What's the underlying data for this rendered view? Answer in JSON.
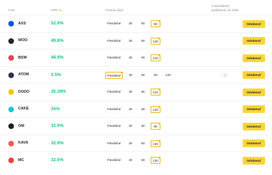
{
  "header": {
    "coin": "Coin",
    "apr": "APR",
    "duration": "Trvanie (dni)",
    "auto_subscribe": "Automatické pridávanie na sobe:"
  },
  "colors": {
    "accent": "#f0b90b",
    "button": "#fcd535",
    "apr": "#0ecb81"
  },
  "rows": [
    {
      "coin": "AXS",
      "apr": "52.9%",
      "icon": "axs-icon",
      "icon_color": "#0055d5",
      "flex": "Flexibilné",
      "durations": [
        "30",
        "60",
        "90"
      ],
      "selected": "90",
      "button": "Odoberať"
    },
    {
      "coin": "WOO",
      "apr": "49.8%",
      "icon": "woo-icon",
      "icon_color": "#20252f",
      "flex": "Flexibilné",
      "durations": [
        "30",
        "60",
        "120"
      ],
      "selected": "120",
      "button": "Odoberať"
    },
    {
      "coin": "BSW",
      "apr": "48.9%",
      "icon": "bsw-icon",
      "icon_color": "#e4405f",
      "flex": "Flexibilné",
      "durations": [
        "30",
        "60",
        "120"
      ],
      "selected": "120",
      "button": "Odoberať"
    },
    {
      "coin": "ATOM",
      "apr": "3.5%",
      "icon": "atom-icon",
      "icon_color": "#2e3148",
      "flex": "Flexibilné",
      "durations": [
        "30",
        "60",
        "90",
        "120"
      ],
      "selected": "Flexibilné",
      "toggle": true,
      "button": "Odoberať"
    },
    {
      "coin": "DODO",
      "apr": "35.39%",
      "icon": "dodo-icon",
      "icon_color": "#f5c400",
      "flex": "Flexibilné",
      "durations": [
        "30",
        "60",
        "120"
      ],
      "selected": "120",
      "button": "Odoberať"
    },
    {
      "coin": "CAKE",
      "apr": "35%",
      "icon": "cake-icon",
      "icon_color": "#1fc7d4",
      "flex": "Flexibilné",
      "durations": [
        "30",
        "60",
        "120"
      ],
      "selected": "120",
      "button": "Odoberať"
    },
    {
      "coin": "OM",
      "apr": "32.9%",
      "icon": "om-icon",
      "icon_color": "#202020",
      "flex": "Flexibilné",
      "durations": [
        "30",
        "60",
        "90"
      ],
      "selected": "90",
      "button": "Odoberať"
    },
    {
      "coin": "KAVA",
      "apr": "32.9%",
      "icon": "kava-icon",
      "icon_color": "#ff564f",
      "flex": "Flexibilné",
      "durations": [
        "30",
        "60",
        "120"
      ],
      "selected": "120",
      "button": "Odoberať"
    },
    {
      "coin": "MC",
      "apr": "32.5%",
      "icon": "mc-icon",
      "icon_color": "#e2473b",
      "flex": "Flexibilné",
      "durations": [
        "30",
        "60",
        "120"
      ],
      "selected": "120",
      "button": "Odoberať"
    }
  ]
}
